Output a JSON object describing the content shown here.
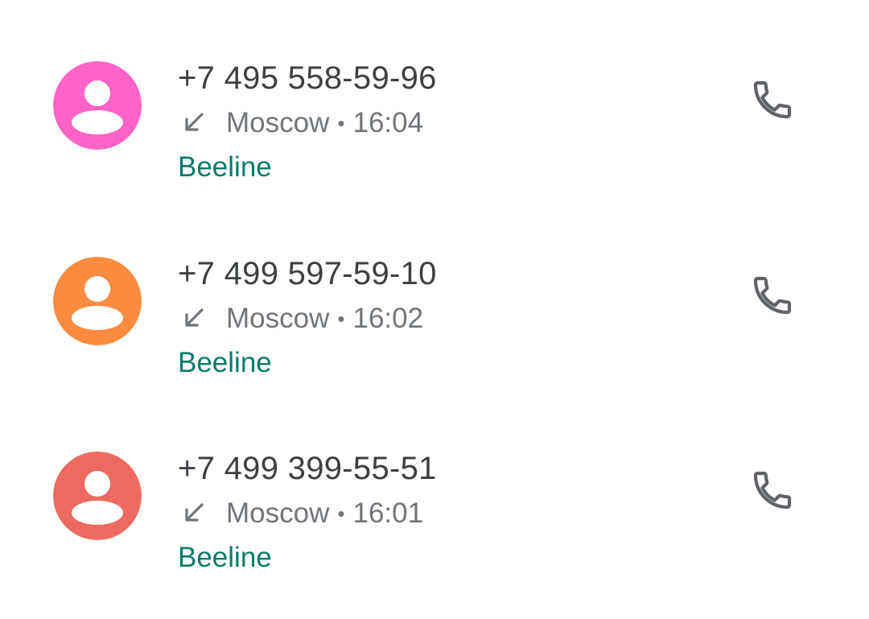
{
  "calls": [
    {
      "number": "+7 495 558-59-96",
      "location": "Moscow",
      "separator": "•",
      "time": "16:04",
      "carrier": "Beeline",
      "avatar_color": "#ff63c6",
      "direction_icon": "incoming-call-arrow",
      "action_icon": "phone-icon"
    },
    {
      "number": "+7 499 597-59-10",
      "location": "Moscow",
      "separator": "•",
      "time": "16:02",
      "carrier": "Beeline",
      "avatar_color": "#fb8b3f",
      "direction_icon": "incoming-call-arrow",
      "action_icon": "phone-icon"
    },
    {
      "number": "+7 499 399-55-51",
      "location": "Moscow",
      "separator": "•",
      "time": "16:01",
      "carrier": "Beeline",
      "avatar_color": "#ec6a5f",
      "direction_icon": "incoming-call-arrow",
      "action_icon": "phone-icon"
    }
  ],
  "colors": {
    "number_text": "#3c4043",
    "meta_text": "#70757a",
    "carrier_text": "#0b7a6b",
    "icon_gray": "#5f6368",
    "background": "#ffffff"
  }
}
